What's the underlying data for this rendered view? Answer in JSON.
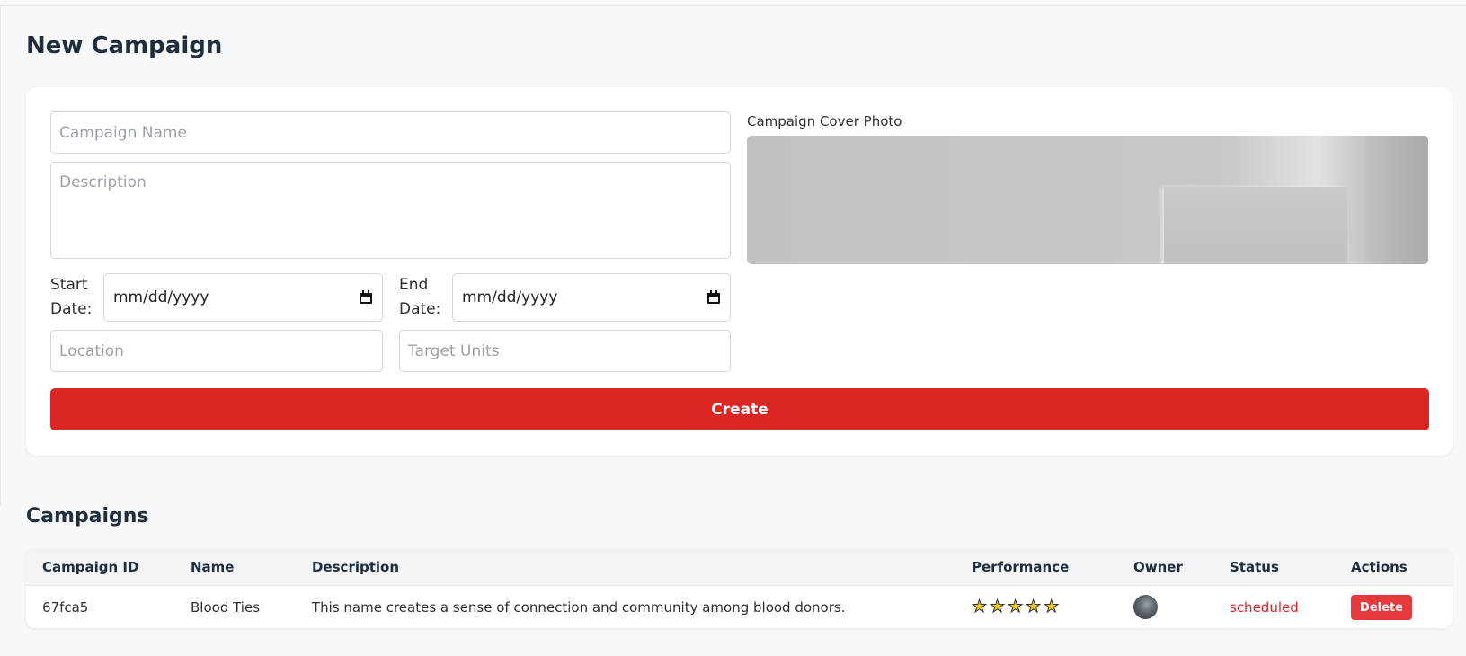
{
  "page": {
    "title": "New Campaign"
  },
  "form": {
    "name_placeholder": "Campaign Name",
    "description_placeholder": "Description",
    "start_date_label": "Start Date:",
    "start_date_value": "mm/dd/yyyy",
    "end_date_label": "End Date:",
    "end_date_value": "mm/dd/yyyy",
    "location_placeholder": "Location",
    "target_units_placeholder": "Target Units",
    "cover_photo_label": "Campaign Cover Photo",
    "create_label": "Create"
  },
  "campaigns": {
    "title": "Campaigns",
    "columns": [
      "Campaign ID",
      "Name",
      "Description",
      "Performance",
      "Owner",
      "Status",
      "Actions"
    ],
    "rows": [
      {
        "id": "67fca5",
        "name": "Blood Ties",
        "description": "This name creates a sense of connection and community among blood donors.",
        "performance_stars": 5,
        "status": "scheduled",
        "action_label": "Delete"
      }
    ]
  },
  "colors": {
    "accent": "#dc2626",
    "delete": "#e5393d",
    "star": "#f5c518"
  },
  "icons": {
    "date_picker": "calendar-icon",
    "rating": "star-icon"
  }
}
